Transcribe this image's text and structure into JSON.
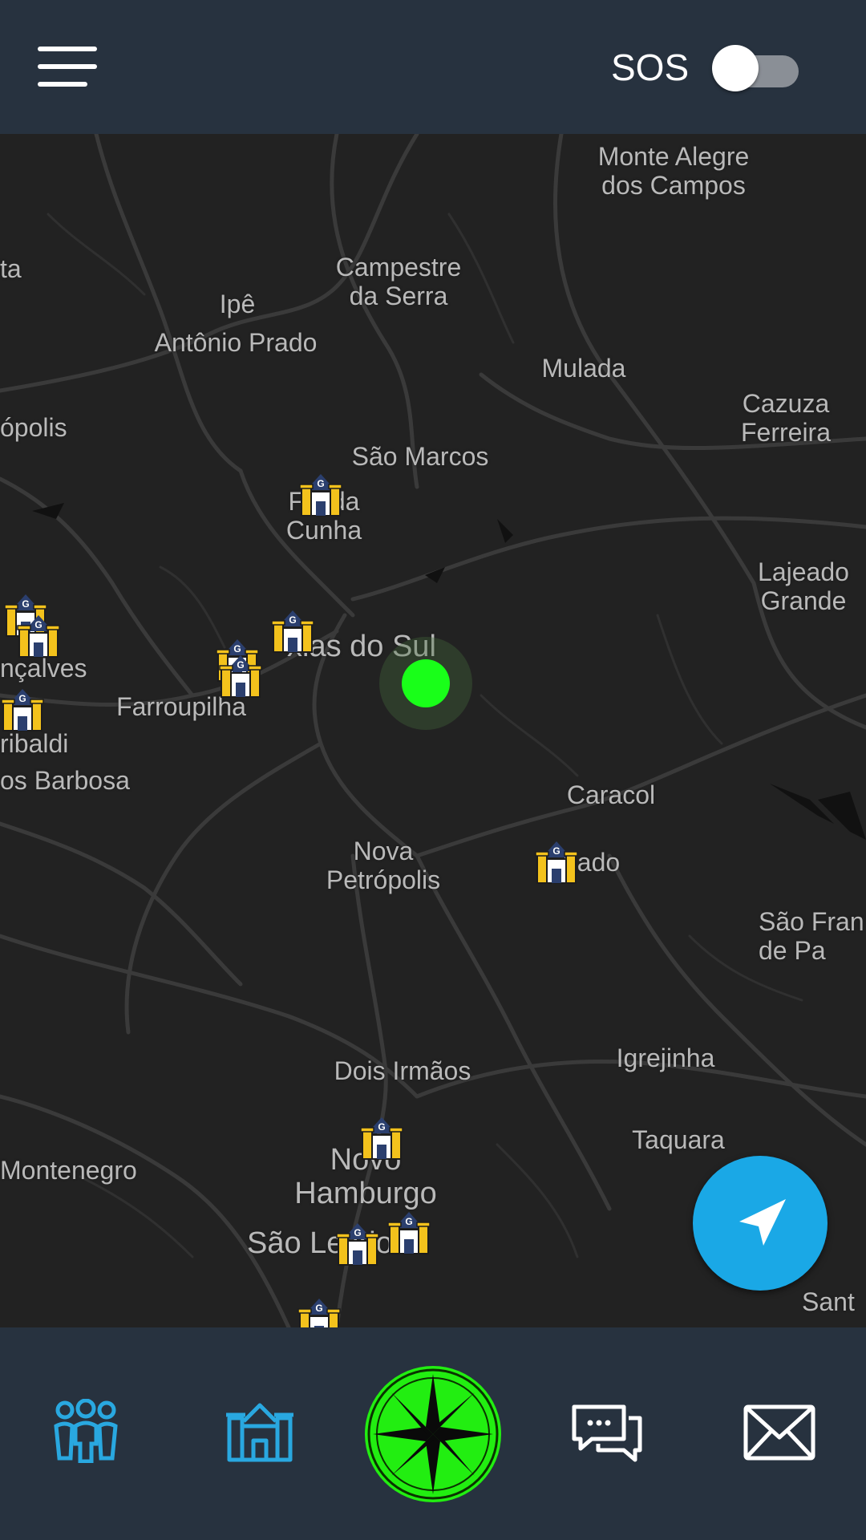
{
  "header": {
    "menu_icon": "hamburger-menu-icon",
    "sos_label": "SOS",
    "sos_enabled": false
  },
  "map": {
    "places": [
      {
        "name": "Monte Alegre\ndos Campos",
        "key": "monte-alegre"
      },
      {
        "name": "ta",
        "key": "ta"
      },
      {
        "name": "Campestre\nda Serra",
        "key": "campestre"
      },
      {
        "name": "Ipê",
        "key": "ipe"
      },
      {
        "name": "Antônio Prado",
        "key": "antonio-prado"
      },
      {
        "name": "Mulada",
        "key": "mulada"
      },
      {
        "name": "Cazuza\nFerreira",
        "key": "cazuza"
      },
      {
        "name": "ópolis",
        "key": "opolis"
      },
      {
        "name": "São Marcos",
        "key": "sao-marcos"
      },
      {
        "name": "Flo    da\nCunha",
        "key": "flores-da-cunha"
      },
      {
        "name": "Lajeado\nGrande",
        "key": "lajeado"
      },
      {
        "name": "xias do Sul",
        "key": "caxias"
      },
      {
        "name": "nçalves",
        "key": "goncalves"
      },
      {
        "name": "Farroupilha",
        "key": "farroupilha"
      },
      {
        "name": "ribaldi",
        "key": "garibaldi"
      },
      {
        "name": "os Barbosa",
        "key": "barbosa"
      },
      {
        "name": "Caracol",
        "key": "caracol"
      },
      {
        "name": "Nova\nPetrópolis",
        "key": "nova-petropolis"
      },
      {
        "name": "nado",
        "key": "gramado"
      },
      {
        "name": "São Fran\nde Pa",
        "key": "sao-francisco"
      },
      {
        "name": "Igrejinha",
        "key": "igrejinha"
      },
      {
        "name": "Dois Irmãos",
        "key": "dois-irmaos"
      },
      {
        "name": "Taquara",
        "key": "taquara"
      },
      {
        "name": "Montenegro",
        "key": "montenegro"
      },
      {
        "name": "Novo\nHamburgo",
        "key": "novo-hamburgo"
      },
      {
        "name": "São Le      ldo",
        "key": "sao-leopoldo"
      },
      {
        "name": "Sant",
        "key": "sant"
      }
    ],
    "marker_letter": "G",
    "marker_icon": "castle-g-icon",
    "user_location_icon": "user-location-dot",
    "recenter_icon": "navigation-arrow-icon",
    "colors": {
      "background": "#222222",
      "roads": "#3a3a3a",
      "user_dot": "#19ff19",
      "fab": "#1aa8e6"
    }
  },
  "bottom_nav": {
    "items": [
      {
        "icon": "group-people-icon"
      },
      {
        "icon": "castle-icon"
      },
      {
        "icon": "compass-rose-icon"
      },
      {
        "icon": "chat-bubbles-icon"
      },
      {
        "icon": "envelope-icon"
      }
    ],
    "colors": {
      "bar": "#27323f",
      "accent": "#29a8e0",
      "compass": "#22ee11"
    }
  }
}
